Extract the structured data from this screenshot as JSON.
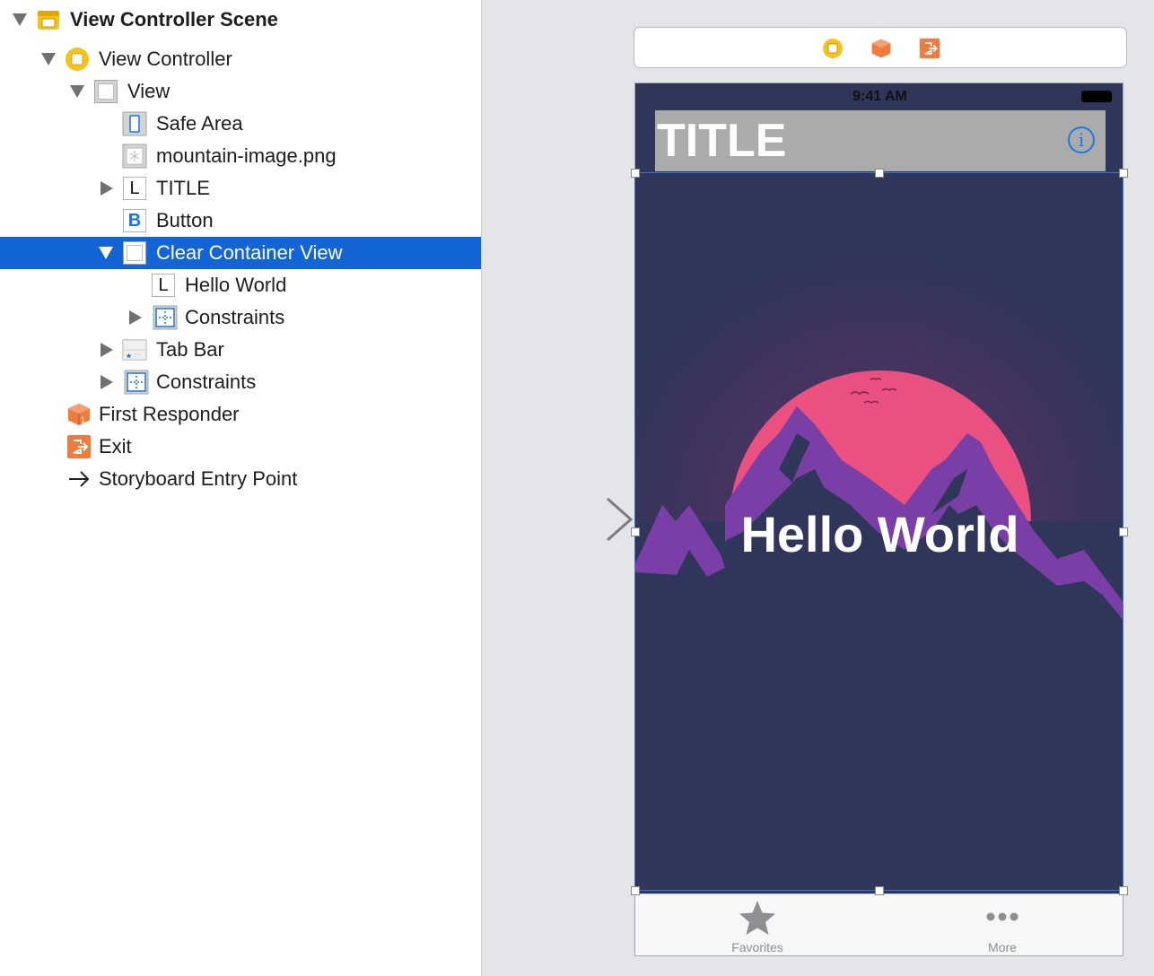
{
  "outline": {
    "items": [
      {
        "label": "View Controller Scene",
        "icon": "scene-icon"
      },
      {
        "label": "View Controller",
        "icon": "view-controller-icon"
      },
      {
        "label": "View",
        "icon": "view-icon"
      },
      {
        "label": "Safe Area",
        "icon": "safe-area-icon"
      },
      {
        "label": "mountain-image.png",
        "icon": "image-view-icon"
      },
      {
        "label": "TITLE",
        "icon": "label-icon",
        "icon_text": "L"
      },
      {
        "label": "Button",
        "icon": "button-icon",
        "icon_text": "B"
      },
      {
        "label": "Clear Container View",
        "icon": "view-icon",
        "selected": true
      },
      {
        "label": "Hello World",
        "icon": "label-icon",
        "icon_text": "L"
      },
      {
        "label": "Constraints",
        "icon": "constraints-icon"
      },
      {
        "label": "Tab Bar",
        "icon": "tab-bar-icon"
      },
      {
        "label": "Constraints",
        "icon": "constraints-icon"
      },
      {
        "label": "First Responder",
        "icon": "first-responder-icon"
      },
      {
        "label": "Exit",
        "icon": "exit-icon"
      },
      {
        "label": "Storyboard Entry Point",
        "icon": "arrow-right-icon"
      }
    ]
  },
  "scene_dock": {
    "icons": [
      "view-controller-icon",
      "first-responder-icon",
      "exit-icon"
    ]
  },
  "phone": {
    "status_time": "9:41 AM",
    "title": "TITLE",
    "info_glyph": "i",
    "hello": "Hello World",
    "tabs": [
      {
        "label": "Favorites",
        "icon": "star-icon"
      },
      {
        "label": "More",
        "icon": "more-dots-icon"
      }
    ]
  },
  "colors": {
    "selection": "#1364d4",
    "phone_background": "#30355a",
    "sun": "#ea5080",
    "mountain_light": "#7a3fa6",
    "mountain_dark": "#30355a",
    "tint_blue": "#1a7be8",
    "scene_yellow": "#f5c31a",
    "responder_orange": "#f07b3f"
  }
}
